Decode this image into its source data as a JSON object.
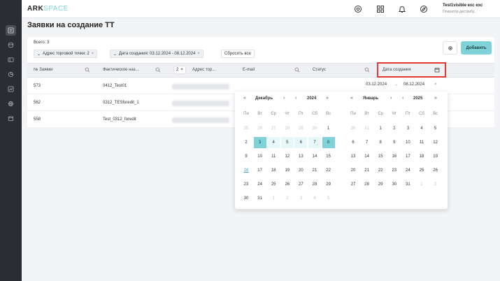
{
  "brand": {
    "ark": "ARK",
    "space": "SPACE"
  },
  "user": {
    "name": "Test1visible exc exc",
    "role": "Оператор дистрибу..."
  },
  "page_title": "Заявки на создание ТТ",
  "total_label": "Всего: 3",
  "filters": {
    "chip1": "Адрес торговой точки: 2",
    "chip2": "Дата создания: 03.12.2024 - 08.12.2024",
    "reset": "Сбросить все",
    "chip_close": "×"
  },
  "add_button": "Добавить",
  "columns": {
    "number": "№ Заявки",
    "actual_name": "Фактическое наз...",
    "address_badge": "2",
    "address": "Адрес тор...",
    "email": "E-mail",
    "status": "Статус",
    "date_created": "Дата создания"
  },
  "rows": [
    {
      "number": "573",
      "name": "0412_Test01"
    },
    {
      "number": "562",
      "name": "0312_TESforedit_1"
    },
    {
      "number": "558",
      "name": "Test_0312_foredit"
    }
  ],
  "range": {
    "from": "03.12.2024",
    "arrow": "→",
    "to": "08.12.2024",
    "clear": "×"
  },
  "calendar": {
    "left": {
      "month": "Декабрь",
      "year": "2024"
    },
    "right": {
      "month": "Январь",
      "year": "2025"
    },
    "arrows": {
      "prev2": "«",
      "prev": "‹",
      "next": "›",
      "next2": "»"
    },
    "weekdays": [
      "Пн",
      "Вт",
      "Ср",
      "Чт",
      "Пт",
      "Сб",
      "Вс"
    ],
    "left_days": [
      [
        "25",
        "26",
        "27",
        "28",
        "29",
        "30",
        "1"
      ],
      [
        "2",
        "3",
        "4",
        "5",
        "6",
        "7",
        "8"
      ],
      [
        "9",
        "10",
        "11",
        "12",
        "13",
        "14",
        "15"
      ],
      [
        "16",
        "17",
        "18",
        "19",
        "20",
        "21",
        "22"
      ],
      [
        "23",
        "24",
        "25",
        "26",
        "27",
        "28",
        "29"
      ],
      [
        "30",
        "31",
        "1",
        "2",
        "3",
        "4",
        "5"
      ]
    ],
    "right_days": [
      [
        "30",
        "31",
        "1",
        "2",
        "3",
        "4",
        "5"
      ],
      [
        "6",
        "7",
        "8",
        "9",
        "10",
        "11",
        "12"
      ],
      [
        "13",
        "14",
        "15",
        "16",
        "17",
        "18",
        "19"
      ],
      [
        "20",
        "21",
        "22",
        "23",
        "24",
        "25",
        "26"
      ],
      [
        "27",
        "28",
        "29",
        "30",
        "31",
        "1",
        "2"
      ]
    ]
  },
  "colors": {
    "accent": "#7fd3d8",
    "highlight": "#e53935",
    "sidebar": "#2b2d33"
  }
}
